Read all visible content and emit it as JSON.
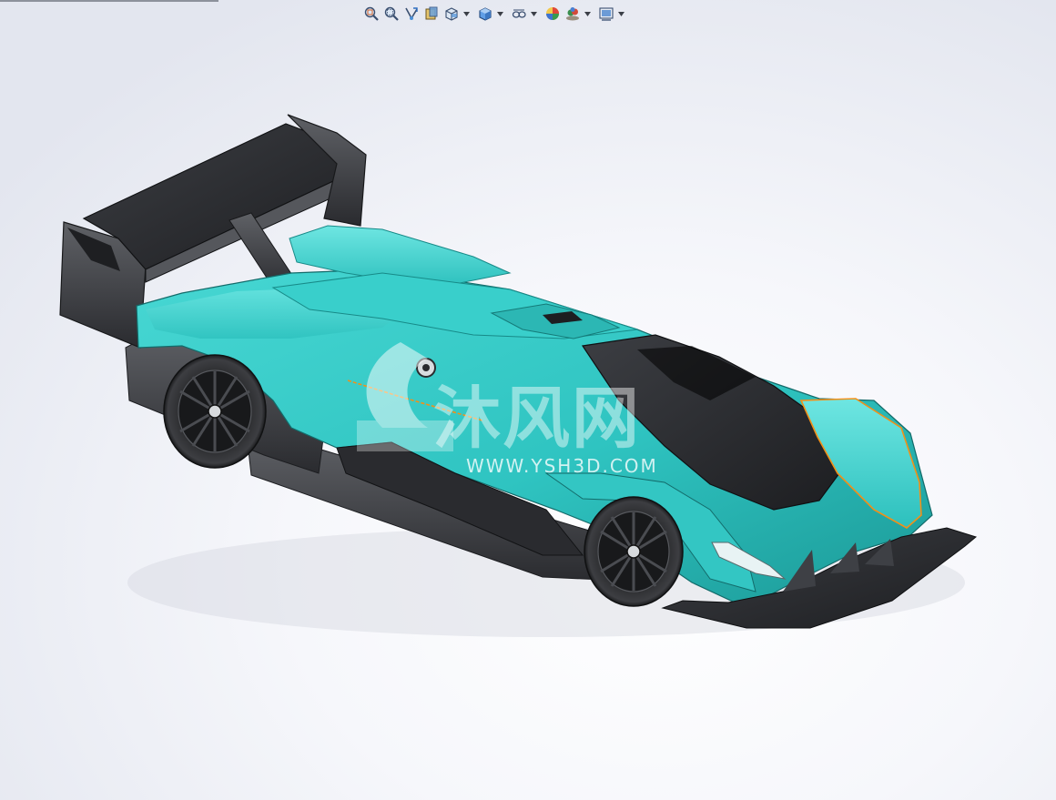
{
  "toolbar": {
    "buttons": [
      {
        "name": "zoom-to-fit",
        "icon": "zoom-fit-icon"
      },
      {
        "name": "zoom-to-area",
        "icon": "zoom-area-icon"
      },
      {
        "name": "previous-view",
        "icon": "previous-view-icon"
      },
      {
        "name": "section-view",
        "icon": "section-view-icon"
      },
      {
        "name": "view-orientation",
        "icon": "view-orientation-icon"
      },
      {
        "name": "display-style",
        "icon": "display-style-icon"
      },
      {
        "name": "hide-show-items",
        "icon": "hide-show-icon"
      },
      {
        "name": "edit-appearance",
        "icon": "edit-appearance-icon"
      },
      {
        "name": "apply-scene",
        "icon": "apply-scene-icon"
      },
      {
        "name": "view-settings",
        "icon": "view-settings-icon"
      }
    ]
  },
  "watermark": {
    "brand_cn": "沐风网",
    "url": "WWW.YSH3D.COM"
  },
  "colors": {
    "body_teal": "#2fc7c4",
    "body_teal_dark": "#1d9c9b",
    "carbon": "#2b2c30",
    "carbon_light": "#55575c",
    "accent_orange": "#f29018",
    "background": "#eef0f5"
  }
}
